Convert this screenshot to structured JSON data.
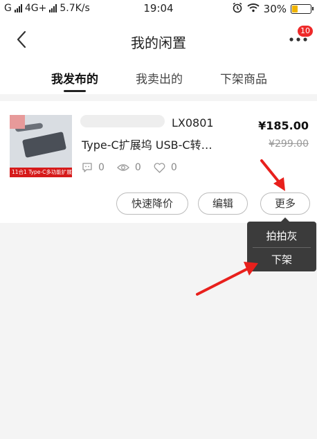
{
  "status_bar": {
    "carrier": "G",
    "network": "4G+",
    "speed": "5.7K/s",
    "time": "19:04",
    "battery": "30%"
  },
  "nav": {
    "title": "我的闲置",
    "badge": "10"
  },
  "tabs": [
    {
      "label": "我发布的",
      "active": true
    },
    {
      "label": "我卖出的",
      "active": false
    },
    {
      "label": "下架商品",
      "active": false
    }
  ],
  "item": {
    "model": "LX0801",
    "description": "Type-C扩展坞 USB-C转…",
    "price": "¥185.00",
    "original_price": "¥299.00",
    "thumb_banner": "11合1 Type-C多功能扩展坞",
    "comments": "0",
    "views": "0",
    "likes": "0"
  },
  "actions": {
    "quick_reduce": "快速降价",
    "edit": "编辑",
    "more": "更多"
  },
  "popup_menu": {
    "item1": "拍拍灰",
    "item2": "下架"
  },
  "colors": {
    "accent_red": "#ee2a2a",
    "arrow_red": "#e8201c",
    "popup_bg": "#3b3b3b"
  }
}
